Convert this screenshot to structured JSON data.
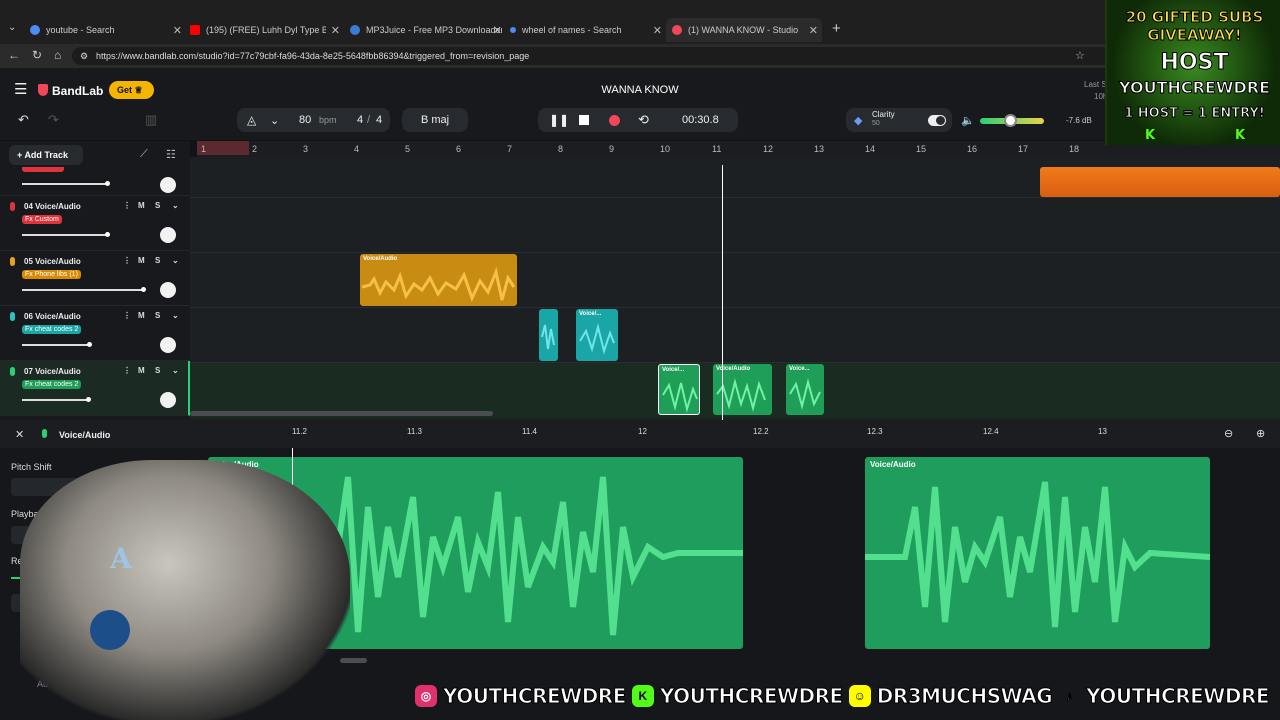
{
  "browser": {
    "tabs": [
      {
        "label": "youtube - Search",
        "color": "#4c8bf5"
      },
      {
        "label": "(195) (FREE) Luhh Dyl Type Be",
        "color": "#ff0000"
      },
      {
        "label": "MP3Juice - Free MP3 Downloader",
        "color": "#3a7bd5"
      },
      {
        "label": "wheel of names - Search",
        "color": "#4c8bf5"
      },
      {
        "label": "(1) WANNA KNOW - Studio",
        "color": "#f2465a"
      }
    ],
    "new_tab": "+",
    "url": "https://www.bandlab.com/studio?id=77c79cbf-fa96-43da-8e25-5648fbb86394&triggered_from=revision_page"
  },
  "app": {
    "brand": "BandLab",
    "get_label": "Get",
    "project_title": "WANNA KNOW",
    "last_saved": "Last S",
    "last_saved_2": "10h",
    "add_track": "Add Track",
    "bpm_value": "80",
    "bpm_unit": "bpm",
    "time_sig_num": "4",
    "time_sig_sep": "/",
    "time_sig_den": "4",
    "key": "B maj",
    "time_display": "00:30.8",
    "clarity_label": "Clarity",
    "clarity_value": "50",
    "volume_db": "-7.6 dB",
    "accent": "#f2465a"
  },
  "ruler": [
    "1",
    "2",
    "3",
    "4",
    "5",
    "6",
    "7",
    "8",
    "9",
    "10",
    "11",
    "12",
    "13",
    "14",
    "15",
    "16",
    "17",
    "18"
  ],
  "tracks": [
    {
      "name": "04 Voice/Audio",
      "fx": "Fx Custom",
      "fx_color": "#e0343c",
      "icon_color": "#e0343c"
    },
    {
      "name": "05 Voice/Audio",
      "fx": "Fx Phone libs (1)",
      "fx_color": "#d98a00",
      "icon_color": "#e8a020"
    },
    {
      "name": "06 Voice/Audio",
      "fx": "Fx cheat codes 2",
      "fx_color": "#1aa6a6",
      "icon_color": "#2cc2c2"
    },
    {
      "name": "07 Voice/Audio",
      "fx": "Fx cheat codes 2",
      "fx_color": "#1e9e57",
      "icon_color": "#2ccf72"
    }
  ],
  "track_buttons": {
    "mute": "M",
    "solo": "S"
  },
  "regions": [
    {
      "label": "Voice/Audio"
    },
    {
      "label": "Voice/..."
    },
    {
      "label": "Voice/..."
    },
    {
      "label": "Voice/Audio"
    },
    {
      "label": "Voice..."
    }
  ],
  "editor": {
    "track_label": "Voice/Audio",
    "ruler": [
      "11.2",
      "11.3",
      "11.4",
      "12",
      "12.2",
      "12.3",
      "12.4",
      "13"
    ],
    "props": [
      "Pitch Shift",
      "Playback Rate",
      "Region Gain"
    ],
    "region_a": "Voice/Audio",
    "region_b": "Voice/Audio",
    "partial_label": "Au"
  },
  "overlay": {
    "banner_line1": "20 GIFTED SUBS",
    "banner_line2": "GIVEAWAY!",
    "banner_line3": "HOST",
    "banner_line4": "YOUTHCREWDRE",
    "banner_line5": "1 HOST = 1 ENTRY!",
    "banner_k": "K",
    "socials": [
      {
        "icon": "instagram-icon",
        "handle": "YOUTHCREWDRE",
        "color": "#e1306c"
      },
      {
        "icon": "kick-icon",
        "handle": "YOUTHCREWDRE",
        "color": "#53fc18"
      },
      {
        "icon": "snapchat-icon",
        "handle": "DR3MUCHSWAG",
        "color": "#fffc00"
      },
      {
        "icon": "tiktok-icon",
        "handle": "YOUTHCREWDRE",
        "color": "#ffffff"
      }
    ]
  }
}
